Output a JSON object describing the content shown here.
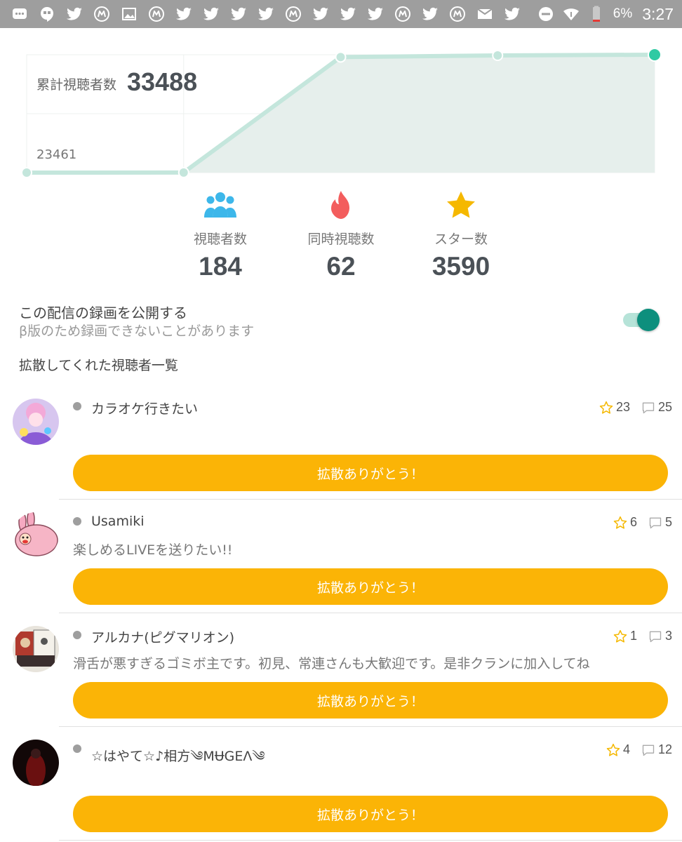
{
  "status_bar": {
    "notification_icons": [
      "chat-icon",
      "hangouts-icon",
      "twitter-icon",
      "m-app-icon",
      "gallery-icon",
      "m-app-icon",
      "twitter-icon",
      "twitter-icon",
      "twitter-icon",
      "twitter-icon",
      "m-app-icon",
      "twitter-icon",
      "twitter-icon",
      "twitter-icon",
      "m-app-icon",
      "twitter-icon",
      "m-app-icon",
      "mail-icon",
      "twitter-icon"
    ],
    "battery": "6%",
    "time": "3:27"
  },
  "chart_data": {
    "type": "area",
    "title": "累計視聴者数",
    "total": "33488",
    "min_label": "23461",
    "values": [
      23461,
      23470,
      33290,
      33430,
      33488
    ],
    "ylim": [
      23461,
      33488
    ],
    "grid": true,
    "colors": {
      "line": "#c4e6dc",
      "fill": "#e6efec",
      "last_point": "#2fcaa3"
    }
  },
  "stats": [
    {
      "icon": "people-icon",
      "label": "視聴者数",
      "value": "184"
    },
    {
      "icon": "fire-icon",
      "label": "同時視聴数",
      "value": "62"
    },
    {
      "icon": "star-icon",
      "label": "スター数",
      "value": "3590"
    }
  ],
  "recording": {
    "title": "この配信の録画を公開する",
    "subtitle": "β版のため録画できないことがあります",
    "enabled": true
  },
  "list_heading": "拡散してくれた視聴者一覧",
  "viewers": [
    {
      "name": "カラオケ行きたい",
      "message": "",
      "stars": "23",
      "comments": "25",
      "button": "拡散ありがとう！"
    },
    {
      "name": "Usamiki",
      "message": "楽しめるLIVEを送りたい!!",
      "stars": "6",
      "comments": "5",
      "button": "拡散ありがとう！"
    },
    {
      "name": "アルカナ(ピグマリオン)",
      "message": "滑舌が悪すぎるゴミボ主です。初見、常連さんも大歓迎です。是非クランに加入してね",
      "stars": "1",
      "comments": "3",
      "button": "拡散ありがとう！"
    },
    {
      "name": "☆はやて☆♪相方༄MɄGEɅ༄",
      "message": "",
      "stars": "4",
      "comments": "12",
      "button": "拡散ありがとう！"
    }
  ],
  "colors": {
    "accent": "#fbb406",
    "toggle": "#0d8f7d",
    "star": "#f5b800",
    "people": "#3db7ea",
    "fire": "#f35d5d"
  }
}
